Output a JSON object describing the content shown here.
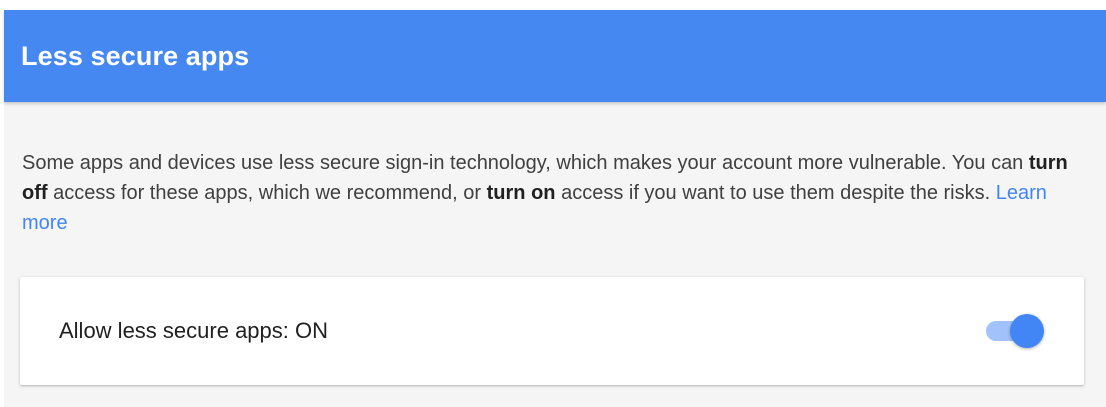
{
  "header": {
    "title": "Less secure apps",
    "color": "#4688f1"
  },
  "description": {
    "part1": "Some apps and devices use less secure sign-in technology, which makes your account more vulnerable. You can ",
    "turn_off": "turn off",
    "part2": " access for these apps, which we recommend, or ",
    "turn_on": "turn on",
    "part3": " access if you want to use them despite the risks. ",
    "learn_more": "Learn more"
  },
  "setting": {
    "label": "Allow less secure apps: ON",
    "toggle_state": "on",
    "toggle_color": "#4285f4"
  }
}
